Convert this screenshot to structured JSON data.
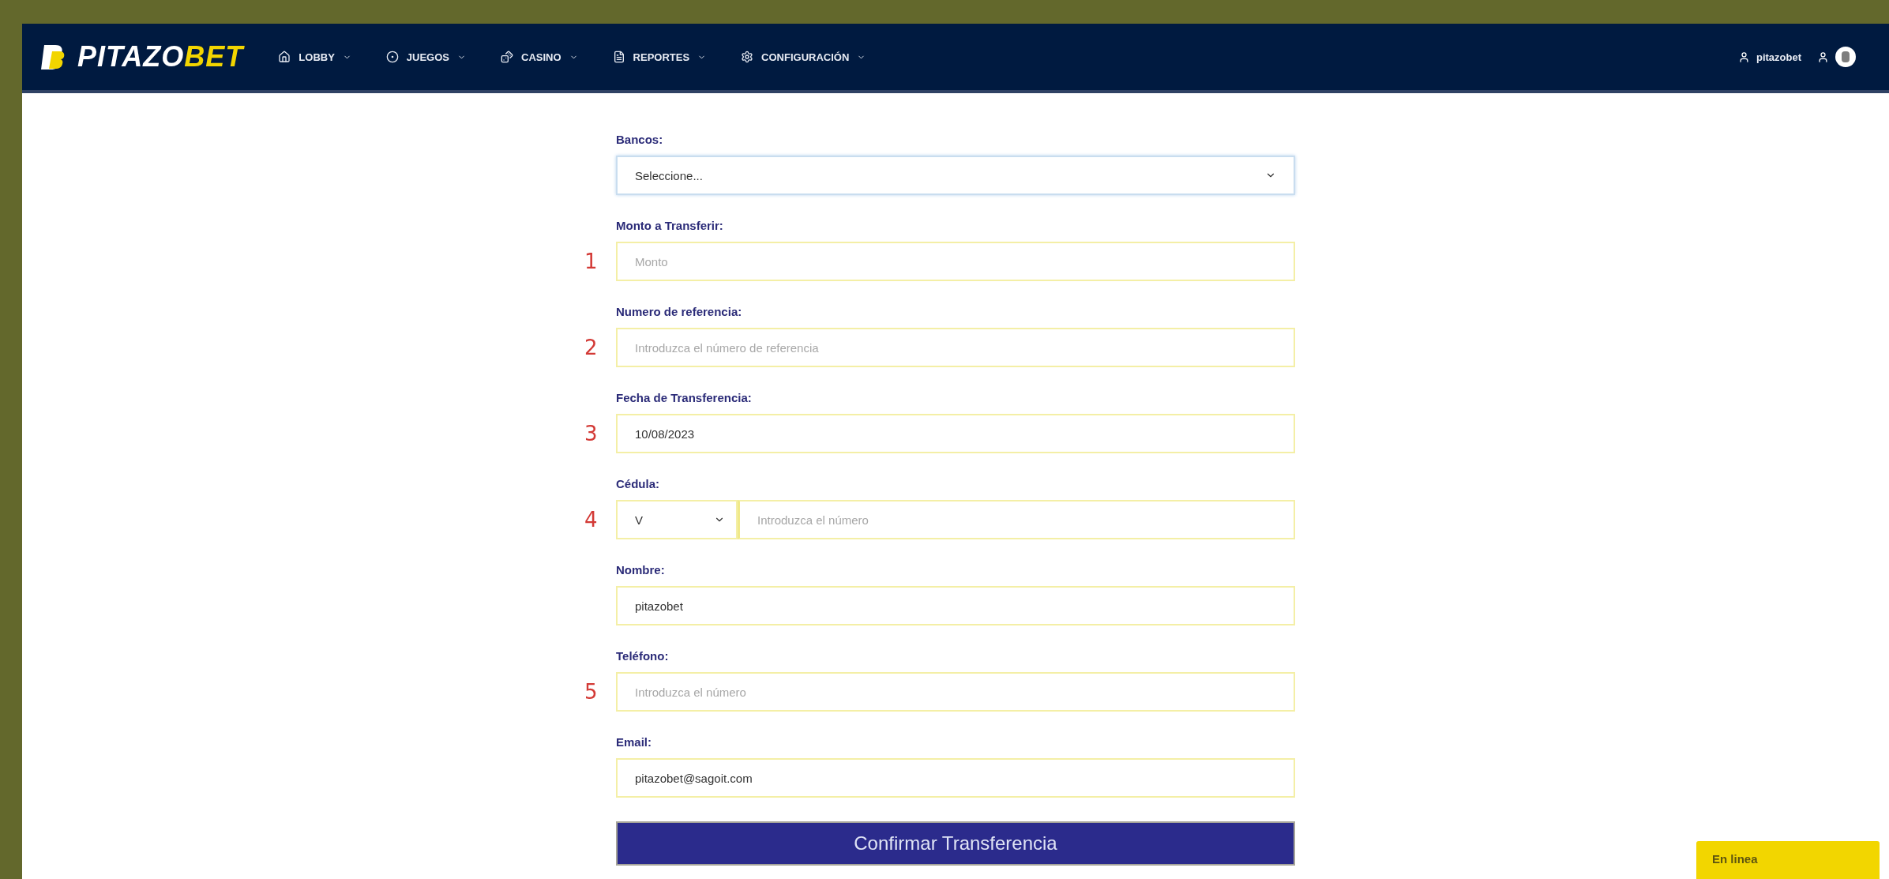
{
  "navbar": {
    "logo": {
      "first": "PITAZO",
      "second": "BET"
    },
    "menu": [
      {
        "label": "LOBBY"
      },
      {
        "label": "JUEGOS"
      },
      {
        "label": "CASINO"
      },
      {
        "label": "REPORTES"
      },
      {
        "label": "CONFIGURACIÓN"
      }
    ],
    "user": "pitazobet"
  },
  "form": {
    "fields": [
      {
        "kind": "select",
        "label": "Bancos:",
        "value": "Seleccione..."
      },
      {
        "kind": "input",
        "label": "Monto a Transferir:",
        "marker": "1",
        "placeholder": "Monto"
      },
      {
        "kind": "input",
        "label": "Numero de referencia:",
        "marker": "2",
        "placeholder": "Introduzca el número de referencia"
      },
      {
        "kind": "input",
        "label": "Fecha de Transferencia:",
        "marker": "3",
        "value": "10/08/2023"
      },
      {
        "kind": "id",
        "label": "Cédula:",
        "marker": "4",
        "prefix": "V",
        "placeholder": "Introduzca el número"
      },
      {
        "kind": "input",
        "label": "Nombre:",
        "value": "pitazobet"
      },
      {
        "kind": "input",
        "label": "Teléfono:",
        "marker": "5",
        "placeholder": "Introduzca el número"
      },
      {
        "kind": "input",
        "label": "Email:",
        "value": "pitazobet@sagoit.com"
      }
    ],
    "submit": "Confirmar Transferencia"
  },
  "status_chip": "En linea"
}
